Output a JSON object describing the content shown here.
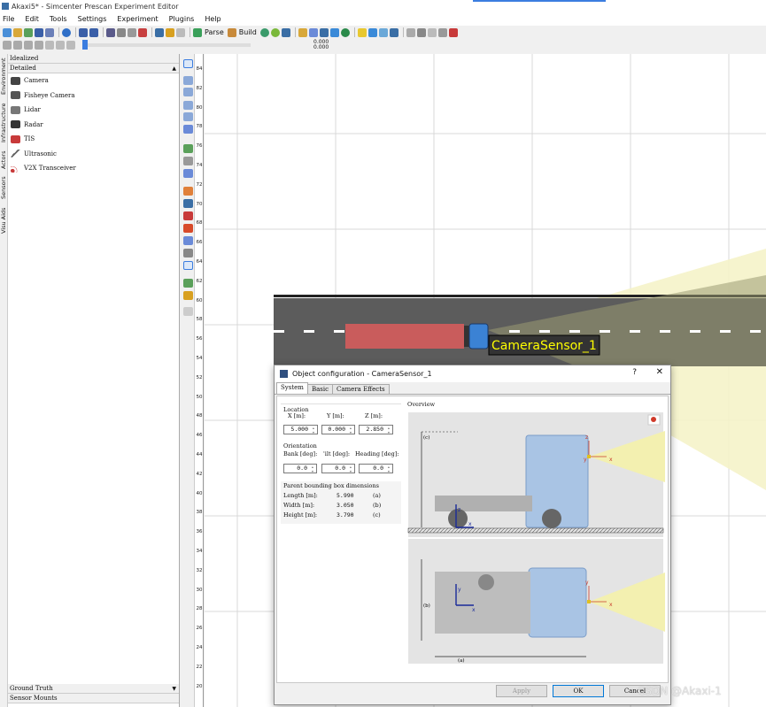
{
  "window": {
    "title": "Akaxi5* - Simcenter Prescan Experiment Editor"
  },
  "menu": [
    "File",
    "Edit",
    "Tools",
    "Settings",
    "Experiment",
    "Plugins",
    "Help"
  ],
  "toolbar": {
    "parse_label": "Parse",
    "build_label": "Build"
  },
  "sim_time": {
    "line1": "0.000",
    "line2": "0.000"
  },
  "left_panel": {
    "vertical_tabs": [
      "Environment",
      "Infrastructure",
      "Actors",
      "Sensors",
      "Visu Aids"
    ],
    "section_idealized": "Idealized",
    "section_detailed": "Detailed",
    "sensors": [
      "Camera",
      "Fisheye Camera",
      "Lidar",
      "Radar",
      "TIS",
      "Ultrasonic",
      "V2X Transceiver"
    ],
    "section_ground_truth": "Ground Truth",
    "section_sensor_mounts": "Sensor Mounts"
  },
  "ruler": {
    "ticks": [
      "84",
      "82",
      "80",
      "78",
      "76",
      "74",
      "72",
      "70",
      "68",
      "66",
      "64",
      "62",
      "60",
      "58",
      "56",
      "54",
      "52",
      "50",
      "48",
      "46",
      "44",
      "42",
      "40",
      "38",
      "36",
      "34",
      "32",
      "30",
      "28",
      "26",
      "24",
      "22",
      "20"
    ]
  },
  "scene": {
    "sensor_label": "CameraSensor_1"
  },
  "dialog": {
    "title": "Object configuration - CameraSensor_1",
    "help": "?",
    "close": "✕",
    "tabs": [
      "System",
      "Basic",
      "Camera Effects"
    ],
    "location": {
      "title": "Location",
      "x_label": "X  [m]:",
      "y_label": "Y  [m]:",
      "z_label": "Z  [m]:",
      "x": "5.000",
      "y": "0.000",
      "z": "2.850"
    },
    "orientation": {
      "title": "Orientation",
      "bank_label": "Bank [deg]:",
      "tilt_label": "'ilt [deg]:",
      "heading_label": "Heading [deg]:",
      "bank": "0.0",
      "tilt": "0.0",
      "heading": "0.0"
    },
    "parent_bbox": {
      "title": "Parent bounding box dimensions",
      "length_label": "Length [m]:",
      "length": "5.990",
      "length_tag": "(a)",
      "width_label": "Width [m]:",
      "width": "3.050",
      "width_tag": "(b)",
      "height_label": "Height [m]:",
      "height": "3.790",
      "height_tag": "(c)"
    },
    "overview": {
      "title": "Overview",
      "tag_c": "(c)",
      "tag_b": "(b)",
      "tag_a": "(a)",
      "axis_x": "x",
      "axis_y": "y",
      "axis_z": "z"
    },
    "buttons": {
      "apply": "Apply",
      "ok": "OK",
      "cancel": "Cancel"
    }
  },
  "watermark": "CSDN @Akaxi-1",
  "colors": {
    "road": "#5a5a5a",
    "trailer": "#c85a5a",
    "cab": "#3a7fd0",
    "cone": "#f3f0b8",
    "accent": "#0078d7"
  }
}
